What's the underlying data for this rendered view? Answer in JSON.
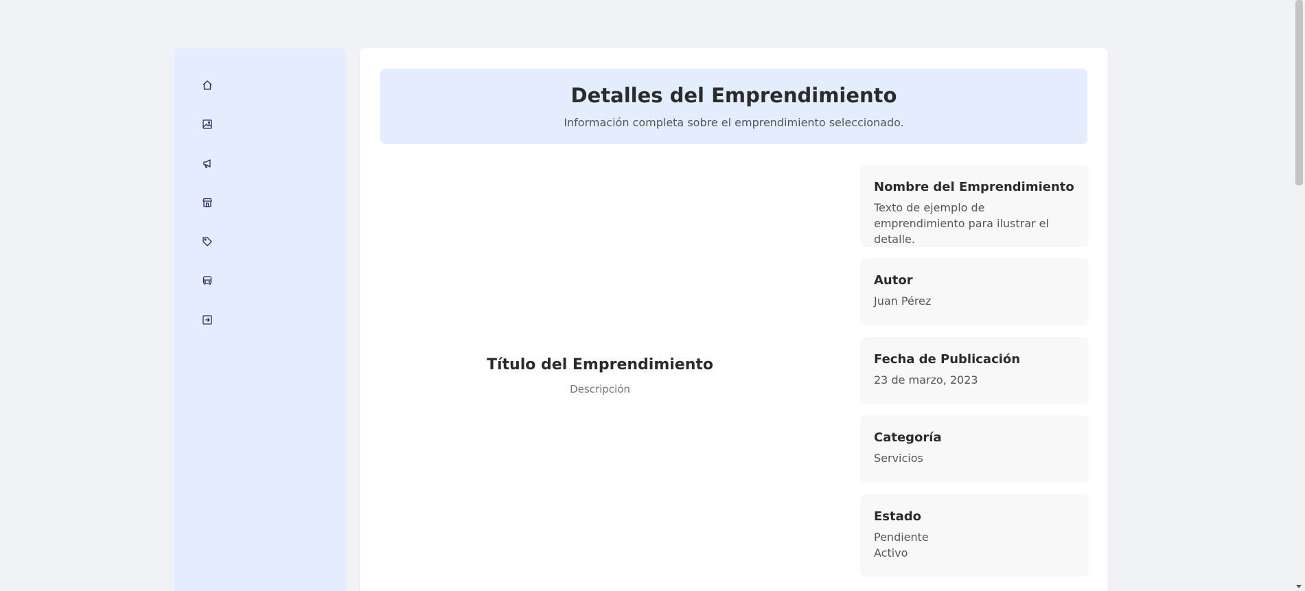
{
  "sidebar": {
    "items": [
      {
        "icon": "home-icon"
      },
      {
        "icon": "image-icon"
      },
      {
        "icon": "megaphone-icon"
      },
      {
        "icon": "store-icon"
      },
      {
        "icon": "tag-icon"
      },
      {
        "icon": "bus-icon"
      },
      {
        "icon": "logout-icon"
      }
    ]
  },
  "header": {
    "title": "Detalles del Emprendimiento",
    "subtitle": "Información completa sobre el emprendimiento seleccionado."
  },
  "preview": {
    "title": "Título del Emprendimiento",
    "description": "Descripción"
  },
  "details": {
    "name": {
      "label": "Nombre del Emprendimiento",
      "value": "Texto de ejemplo de emprendimiento para ilustrar el detalle."
    },
    "author": {
      "label": "Autor",
      "value": "Juan Pérez"
    },
    "date": {
      "label": "Fecha de Publicación",
      "value": "23 de marzo, 2023"
    },
    "category": {
      "label": "Categoría",
      "value": "Servicios"
    },
    "status": {
      "label": "Estado",
      "values": [
        "Pendiente",
        "Activo"
      ]
    }
  },
  "colors": {
    "accent": "#e3edfe",
    "icon": "#2a2560"
  }
}
